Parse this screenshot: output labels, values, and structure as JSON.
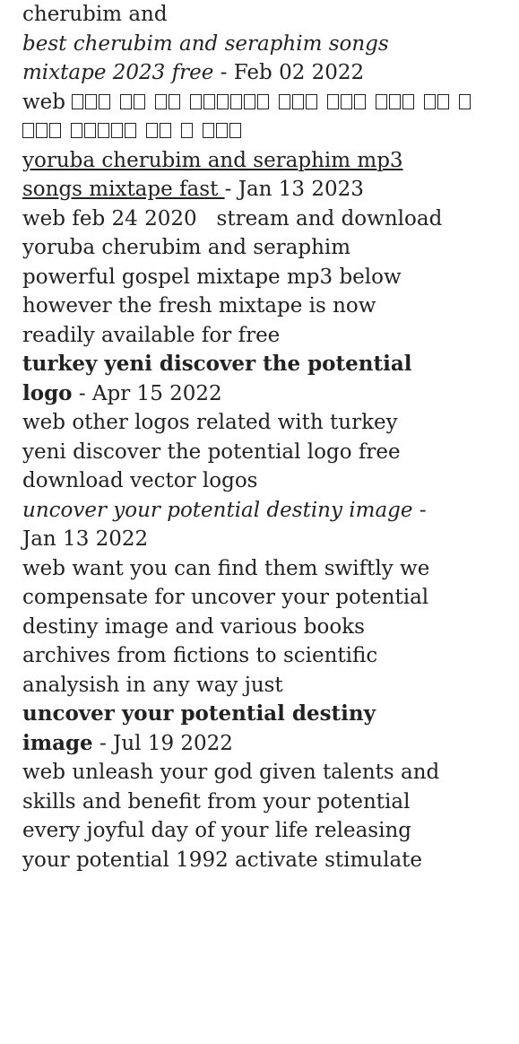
{
  "entries": [
    {
      "title_lines": [
        "cherubim and"
      ],
      "title_style": "plain",
      "date": "",
      "body_lines": []
    },
    {
      "title_lines": [
        "best cherubim and seraphim songs",
        "mixtape 2023 free"
      ],
      "title_style": "italic",
      "date": "Feb 02 2022",
      "body_prefix": "web",
      "body_tofu_line1": [
        3,
        2,
        2,
        6,
        3,
        3,
        3,
        2,
        1
      ],
      "body_tofu_line2": [
        3,
        5,
        2,
        1,
        3
      ]
    },
    {
      "title_lines": [
        "yoruba cherubim and seraphim mp3",
        "songs mixtape fast "
      ],
      "title_style": "link",
      "date": "Jan 13 2023",
      "body_lines": [
        "web feb 24 2020   stream and download",
        "yoruba cherubim and seraphim",
        "powerful gospel mixtape mp3 below",
        "however the fresh mixtape is now",
        "readily available for free"
      ]
    },
    {
      "title_lines": [
        "turkey yeni discover the potential",
        "logo"
      ],
      "title_style": "bold",
      "date": "Apr 15 2022",
      "body_lines": [
        "web other logos related with turkey",
        "yeni discover the potential logo free",
        "download vector logos"
      ]
    },
    {
      "title_lines": [
        "uncover your potential destiny image ",
        ""
      ],
      "title_style": "italic",
      "date": "Jan 13 2022",
      "body_lines": [
        "web want you can find them swiftly we",
        "compensate for uncover your potential",
        "destiny image and various books",
        "archives from fictions to scientific",
        "analysish in any way just"
      ]
    },
    {
      "title_lines": [
        "uncover your potential destiny",
        "image"
      ],
      "title_style": "bold",
      "date": "Jul 19 2022",
      "body_lines": [
        "web unleash your god given talents and",
        "skills and benefit from your potential",
        "every joyful day of your life releasing",
        "your potential 1992 activate stimulate"
      ]
    }
  ],
  "separator": " - "
}
